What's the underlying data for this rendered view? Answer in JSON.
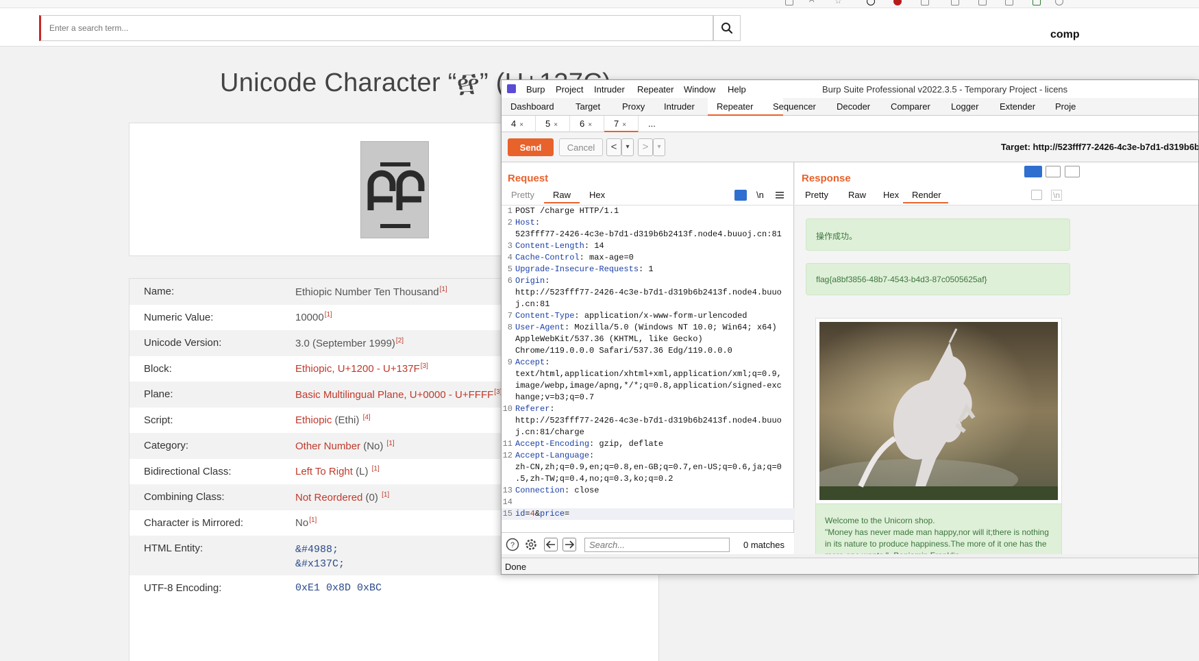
{
  "site": {
    "search_placeholder": "Enter a search term...",
    "brand": "comp",
    "page_title": "Unicode Character “፼” (U+137C)"
  },
  "properties": [
    {
      "label": "Name:",
      "value": "Ethiopic Number Ten Thousand",
      "cite": "[1]"
    },
    {
      "label": "Numeric Value:",
      "value": "10000",
      "cite": "[1]"
    },
    {
      "label": "Unicode Version:",
      "value": "3.0 (September 1999)",
      "cite": "[2]"
    },
    {
      "label": "Block:",
      "value": "Ethiopic, U+1200 - U+137F",
      "cite": "[3]"
    },
    {
      "label": "Plane:",
      "value": "Basic Multilingual Plane, U+0000 - U+FFFF",
      "cite": "[3]"
    },
    {
      "label": "Script:",
      "value": "Ethiopic",
      "value_extra": " (Ethi) ",
      "cite": "[4]"
    },
    {
      "label": "Category:",
      "value": "Other Number",
      "value_extra": " (No) ",
      "cite": "[1]"
    },
    {
      "label": "Bidirectional Class:",
      "value": "Left To Right",
      "value_extra": " (L) ",
      "cite": "[1]"
    },
    {
      "label": "Combining Class:",
      "value": "Not Reordered",
      "value_extra": " (0) ",
      "cite": "[1]"
    },
    {
      "label": "Character is Mirrored:",
      "value": "No",
      "cite": "[1]"
    },
    {
      "label": "HTML Entity:",
      "value": "&#4988;",
      "value2": "&#x137C;"
    },
    {
      "label": "UTF-8 Encoding:",
      "value": "0xE1 0x8D 0xBC"
    }
  ],
  "burp": {
    "menu": [
      "Burp",
      "Project",
      "Intruder",
      "Repeater",
      "Window",
      "Help"
    ],
    "window_title": "Burp Suite Professional v2022.3.5 - Temporary Project - licens",
    "main_tabs": [
      "Dashboard",
      "Target",
      "Proxy",
      "Intruder",
      "Repeater",
      "Sequencer",
      "Decoder",
      "Comparer",
      "Logger",
      "Extender",
      "Proje"
    ],
    "sub_tabs": [
      "4",
      "5",
      "6",
      "7",
      "..."
    ],
    "close_glyph": "×",
    "send_label": "Send",
    "cancel_label": "Cancel",
    "nav_back": "<",
    "nav_forward": ">",
    "nav_dropdown": "▾",
    "target": "Target: http://523fff77-2426-4c3e-b7d1-d319b6b",
    "request_heading": "Request",
    "response_heading": "Response",
    "request_views": [
      "Pretty",
      "Raw",
      "Hex"
    ],
    "response_views": [
      "Pretty",
      "Raw",
      "Hex",
      "Render"
    ],
    "newline_toggle": "\\n",
    "request_lines": [
      {
        "n": "1",
        "k": "",
        "v": "POST /charge HTTP/1.1"
      },
      {
        "n": "2",
        "k": "Host",
        "v": ""
      },
      {
        "n": "",
        "k": "",
        "v": "523fff77-2426-4c3e-b7d1-d319b6b2413f.node4.buuoj.cn:81"
      },
      {
        "n": "3",
        "k": "Content-Length",
        "v": " 14"
      },
      {
        "n": "4",
        "k": "Cache-Control",
        "v": " max-age=0"
      },
      {
        "n": "5",
        "k": "Upgrade-Insecure-Requests",
        "v": " 1"
      },
      {
        "n": "6",
        "k": "Origin",
        "v": ""
      },
      {
        "n": "",
        "k": "",
        "v": "http://523fff77-2426-4c3e-b7d1-d319b6b2413f.node4.buuo"
      },
      {
        "n": "",
        "k": "",
        "v": "j.cn:81"
      },
      {
        "n": "7",
        "k": "Content-Type",
        "v": " application/x-www-form-urlencoded"
      },
      {
        "n": "8",
        "k": "User-Agent",
        "v": " Mozilla/5.0 (Windows NT 10.0; Win64; x64)"
      },
      {
        "n": "",
        "k": "",
        "v": "AppleWebKit/537.36 (KHTML, like Gecko)"
      },
      {
        "n": "",
        "k": "",
        "v": "Chrome/119.0.0.0 Safari/537.36 Edg/119.0.0.0"
      },
      {
        "n": "9",
        "k": "Accept",
        "v": ""
      },
      {
        "n": "",
        "k": "",
        "v": "text/html,application/xhtml+xml,application/xml;q=0.9,"
      },
      {
        "n": "",
        "k": "",
        "v": "image/webp,image/apng,*/*;q=0.8,application/signed-exc"
      },
      {
        "n": "",
        "k": "",
        "v": "hange;v=b3;q=0.7"
      },
      {
        "n": "10",
        "k": "Referer",
        "v": ""
      },
      {
        "n": "",
        "k": "",
        "v": "http://523fff77-2426-4c3e-b7d1-d319b6b2413f.node4.buuo"
      },
      {
        "n": "",
        "k": "",
        "v": "j.cn:81/charge"
      },
      {
        "n": "11",
        "k": "Accept-Encoding",
        "v": " gzip, deflate"
      },
      {
        "n": "12",
        "k": "Accept-Language",
        "v": ""
      },
      {
        "n": "",
        "k": "",
        "v": "zh-CN,zh;q=0.9,en;q=0.8,en-GB;q=0.7,en-US;q=0.6,ja;q=0"
      },
      {
        "n": "",
        "k": "",
        "v": ".5,zh-TW;q=0.4,no;q=0.3,ko;q=0.2"
      },
      {
        "n": "13",
        "k": "Connection",
        "v": " close"
      },
      {
        "n": "14",
        "k": "",
        "v": ""
      },
      {
        "n": "15",
        "k": "",
        "v": "",
        "body": true
      }
    ],
    "body": {
      "p1": "id",
      "eq": "=",
      "v1": "4",
      "amp": "&",
      "p2": "price",
      "eq2": "="
    },
    "search_placeholder": "Search...",
    "matches": "0 matches",
    "status": "Done"
  },
  "render": {
    "alert_success": "操作成功。",
    "alert_flag": "flag{a8bf3856-48b7-4543-b4d3-87c0505625af}",
    "welcome_title": "Welcome to the Unicorn shop.",
    "welcome_quote": "\"Money has never made man happy,nor will it;there is nothing in its nature to produce happiness.The more of it one has the more one wants.\" -Benjamin Franklin"
  },
  "colors": {
    "burp_accent": "#e8622c",
    "link_red": "#c0392b",
    "alert_green_bg": "#dff0d8",
    "alert_green_text": "#3c763d"
  }
}
